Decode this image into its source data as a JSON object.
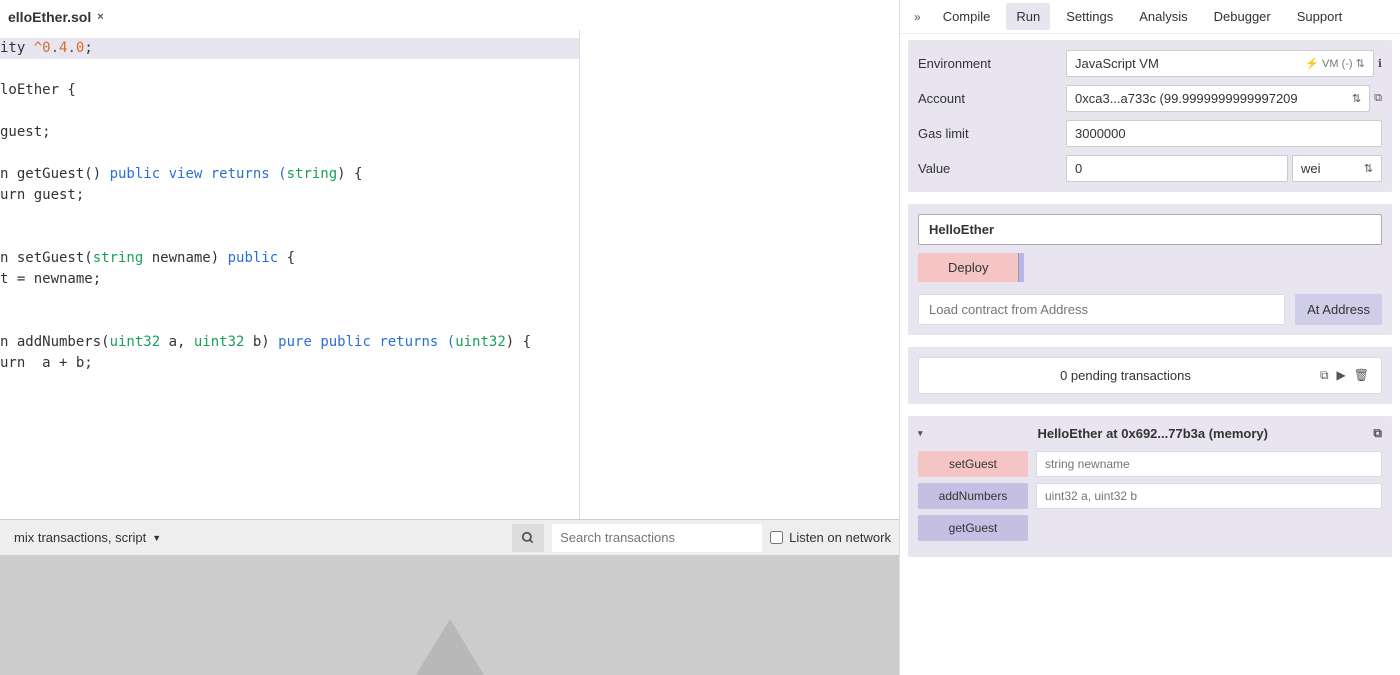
{
  "file": {
    "name": "elloEther.sol"
  },
  "code": {
    "line1_a": "ity ",
    "line1_b": "^0",
    "line1_c": ".",
    "line1_d": "4",
    "line1_e": ".",
    "line1_f": "0",
    "line1_g": ";",
    "line3_a": "loEther {",
    "line5_a": "guest;",
    "line7_a": "n getGuest() ",
    "line7_b": "public",
    "line7_c": " view returns (",
    "line7_d": "string",
    "line7_e": ") {",
    "line8_a": "urn guest;",
    "line11_a": "n setGuest(",
    "line11_b": "string",
    "line11_c": " newname) ",
    "line11_d": "public",
    "line11_e": " {",
    "line12_a": "t = newname;",
    "line15_a": "n addNumbers(",
    "line15_b": "uint32",
    "line15_c": " a, ",
    "line15_d": "uint32",
    "line15_e": " b) ",
    "line15_f": "pure",
    "line15_g": " public returns (",
    "line15_h": "uint32",
    "line15_i": ") {",
    "line16_a": "urn  a + b;"
  },
  "terminal": {
    "dropdown": "mix transactions, script",
    "search_placeholder": "Search transactions",
    "listen_label": "Listen on network"
  },
  "tabs": {
    "compile": "Compile",
    "run": "Run",
    "settings": "Settings",
    "analysis": "Analysis",
    "debugger": "Debugger",
    "support": "Support"
  },
  "env": {
    "label": "Environment",
    "value": "JavaScript VM",
    "vm_indicator": "VM (-)"
  },
  "account": {
    "label": "Account",
    "value": "0xca3...a733c (99.9999999999997209"
  },
  "gas": {
    "label": "Gas limit",
    "value": "3000000"
  },
  "value": {
    "label": "Value",
    "value": "0",
    "unit": "wei"
  },
  "deploy": {
    "contract": "HelloEther",
    "button": "Deploy",
    "load_placeholder": "Load contract from Address",
    "at_address": "At Address"
  },
  "pending": {
    "text": "0 pending transactions"
  },
  "instance": {
    "title": "HelloEther at 0x692...77b3a (memory)",
    "functions": [
      {
        "name": "setGuest",
        "type": "write",
        "placeholder": "string newname"
      },
      {
        "name": "addNumbers",
        "type": "read",
        "placeholder": "uint32 a, uint32 b"
      },
      {
        "name": "getGuest",
        "type": "read",
        "placeholder": ""
      }
    ]
  }
}
